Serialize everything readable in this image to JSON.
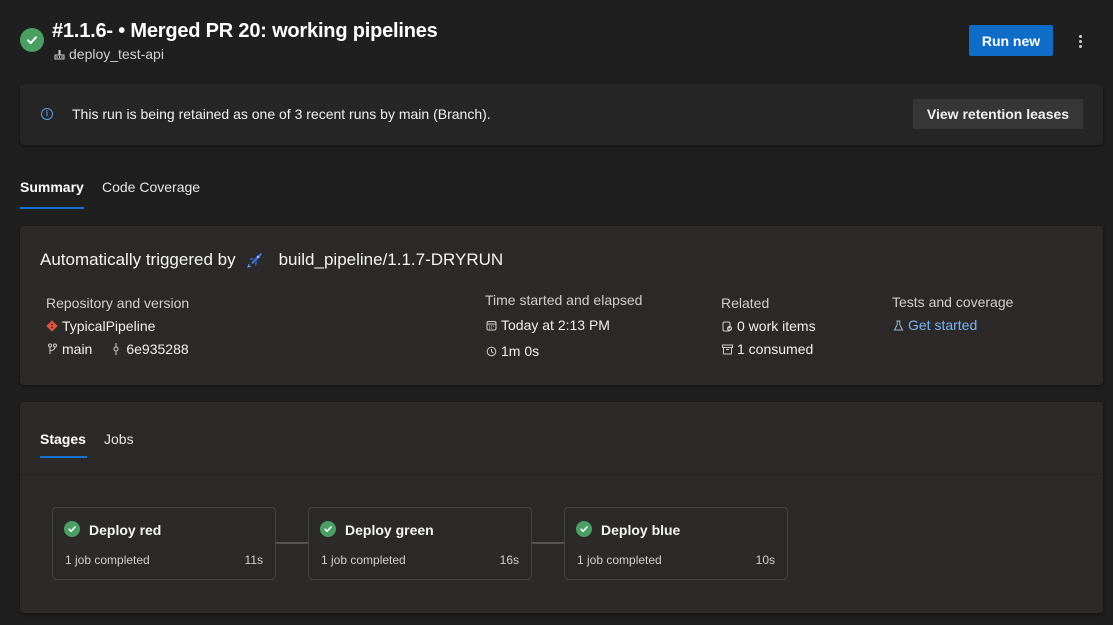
{
  "header": {
    "status": "succeeded",
    "title": "#1.1.6- • Merged PR 20: working pipelines",
    "pipeline_name": "deploy_test-api",
    "pipeline_icon": "pipeline-icon",
    "run_new_label": "Run new",
    "more_icon": "more-vertical-icon"
  },
  "banner": {
    "icon": "info-icon",
    "info_glyph": "i",
    "message": "This run is being retained as one of 3 recent runs by main (Branch).",
    "button_label": "View retention leases"
  },
  "tabs": [
    {
      "label": "Summary",
      "active": true
    },
    {
      "label": "Code Coverage",
      "active": false
    }
  ],
  "summary": {
    "trigger_prefix": "Automatically triggered by",
    "trigger_icon": "rocket-icon",
    "trigger_source": "build_pipeline/1.1.7-DRYRUN",
    "repository": {
      "label": "Repository and version",
      "repo_name": "TypicalPipeline",
      "repo_icon": "git-repo-icon",
      "branch": "main",
      "branch_icon": "branch-icon",
      "commit": "6e935288",
      "commit_icon": "commit-icon"
    },
    "time": {
      "label": "Time started and elapsed",
      "started": "Today at 2:13 PM",
      "started_icon": "calendar-icon",
      "elapsed": "1m 0s",
      "elapsed_icon": "clock-icon"
    },
    "related": {
      "label": "Related",
      "work_items": "0 work items",
      "work_items_icon": "work-item-icon",
      "consumed": "1 consumed",
      "consumed_icon": "artifact-icon"
    },
    "tests": {
      "label": "Tests and coverage",
      "link": "Get started",
      "icon": "beaker-icon"
    }
  },
  "stages_panel": {
    "tabs": [
      {
        "label": "Stages",
        "active": true
      },
      {
        "label": "Jobs",
        "active": false
      }
    ],
    "stages": [
      {
        "name": "Deploy red",
        "status": "succeeded",
        "jobs": "1 job completed",
        "duration": "11s"
      },
      {
        "name": "Deploy green",
        "status": "succeeded",
        "jobs": "1 job completed",
        "duration": "16s"
      },
      {
        "name": "Deploy blue",
        "status": "succeeded",
        "jobs": "1 job completed",
        "duration": "10s"
      }
    ]
  },
  "colors": {
    "success": "#4aa063",
    "primary": "#0f6cc7",
    "link": "#78b4f5",
    "repo": "#e0533c"
  }
}
